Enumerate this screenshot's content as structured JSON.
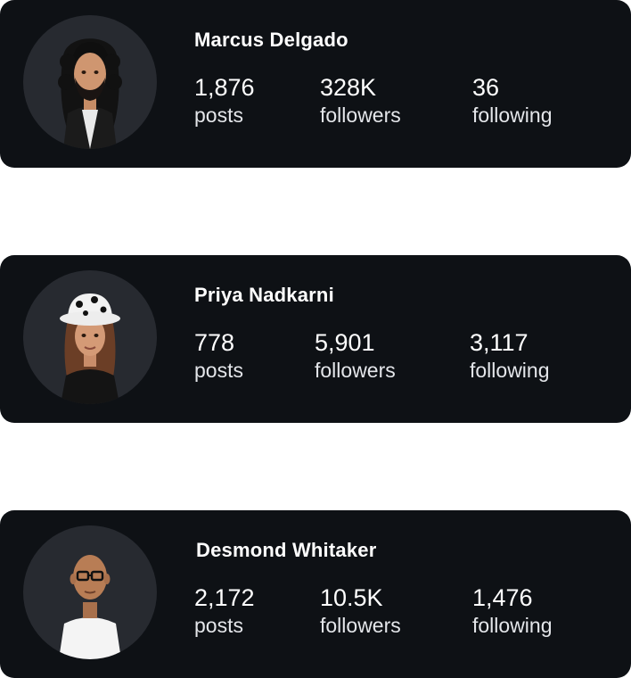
{
  "profiles": [
    {
      "name": "Marcus Delgado",
      "avatar_icon": "avatar-long-curly-hair-beard-icon",
      "stats": [
        {
          "value": "1,876",
          "label": "posts"
        },
        {
          "value": "328K",
          "label": "followers"
        },
        {
          "value": "36",
          "label": "following"
        }
      ]
    },
    {
      "name": "Priya Nadkarni",
      "avatar_icon": "avatar-bucket-hat-icon",
      "stats": [
        {
          "value": "778",
          "label": "posts"
        },
        {
          "value": "5,901",
          "label": "followers"
        },
        {
          "value": "3,117",
          "label": "following"
        }
      ]
    },
    {
      "name": "Desmond Whitaker",
      "avatar_icon": "avatar-bald-glasses-icon",
      "stats": [
        {
          "value": "2,172",
          "label": "posts"
        },
        {
          "value": "10.5K",
          "label": "followers"
        },
        {
          "value": "1,476",
          "label": "following"
        }
      ]
    }
  ],
  "colors": {
    "card_background": "#0e1115",
    "avatar_background": "#272a30",
    "text_primary": "#ffffff",
    "text_secondary": "#e4e6ea"
  }
}
